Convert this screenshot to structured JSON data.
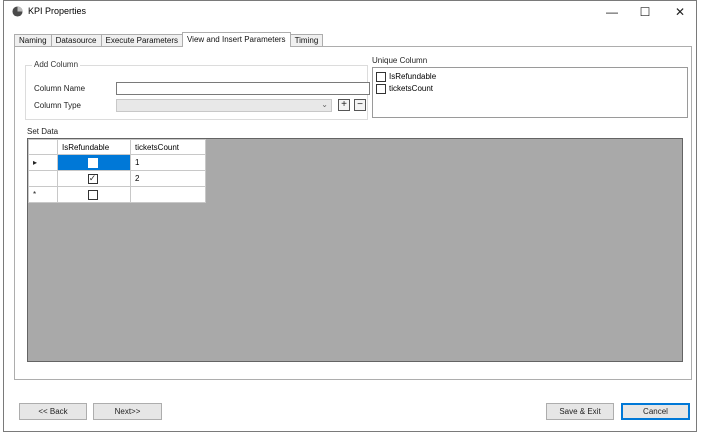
{
  "window": {
    "title": "KPI Properties",
    "minimize": "—",
    "maximize": "☐",
    "close": "✕"
  },
  "tabs": [
    {
      "label": "Naming"
    },
    {
      "label": "Datasource"
    },
    {
      "label": "Execute Parameters"
    },
    {
      "label": "View and Insert Parameters"
    },
    {
      "label": "Timing"
    }
  ],
  "add_column": {
    "title": "Add Column",
    "column_name_label": "Column Name",
    "column_name_value": "",
    "column_type_label": "Column Type",
    "column_type_value": "",
    "add_symbol": "+",
    "remove_symbol": "−"
  },
  "unique_column": {
    "title": "Unique Column",
    "items": [
      {
        "label": "IsRefundable",
        "checked": false
      },
      {
        "label": "ticketsCount",
        "checked": false
      }
    ]
  },
  "set_data": {
    "title": "Set Data",
    "columns": [
      "IsRefundable",
      "ticketsCount"
    ],
    "rows": [
      {
        "header": "▸",
        "isRefundable": false,
        "ticketsCount": "1"
      },
      {
        "header": "",
        "isRefundable": true,
        "ticketsCount": "2"
      },
      {
        "header": "*",
        "isRefundable": false,
        "ticketsCount": ""
      }
    ]
  },
  "footer": {
    "back": "<< Back",
    "next": "Next>>",
    "save_exit": "Save & Exit",
    "cancel": "Cancel"
  },
  "colors": {
    "selection": "#0078d7",
    "grid_background": "#a9a9a9"
  }
}
